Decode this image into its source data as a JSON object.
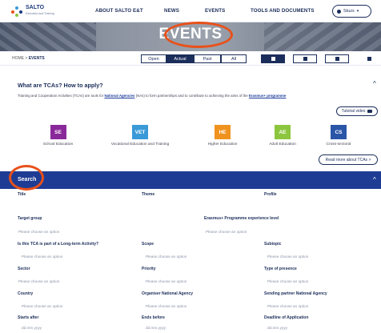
{
  "header": {
    "logo_text": "SALTO",
    "logo_sub": "Education and Training",
    "nav": [
      "ABOUT SALTO E&T",
      "NEWS",
      "EVENTS",
      "TOOLS AND DOCUMENTS"
    ],
    "user_label": "Stuzs"
  },
  "banner": {
    "title": "EVENTS"
  },
  "breadcrumb": {
    "home": "HOME",
    "separator": ">",
    "current": "EVENTS"
  },
  "filters": {
    "time": [
      "Open",
      "Actual",
      "Past",
      "All"
    ],
    "active_time": "Actual"
  },
  "info": {
    "title": "What are TCAs? How to apply?",
    "text_before": "Training and Cooperation Activities (TCAs) are tools for ",
    "link1": "National Agencies",
    "text_middle": " (NAs) to form partnerships and to contribute to achieving the aims of the ",
    "link2": "Erasmus+ programme",
    "tutorial_label": "Tutorial video",
    "more_label": "Read more about TCAs >"
  },
  "categories": [
    {
      "code": "SE",
      "label": "School Education",
      "color": "#8a2a9a"
    },
    {
      "code": "VET",
      "label": "Vocational Education and Training",
      "color": "#3a9ad8"
    },
    {
      "code": "HE",
      "label": "Higher Education",
      "color": "#f0921e"
    },
    {
      "code": "AE",
      "label": "Adult Education",
      "color": "#8cc63f"
    },
    {
      "code": "CS",
      "label": "Cross-sectoral",
      "color": "#2a56a8"
    }
  ],
  "search": {
    "label": "Search",
    "fields": {
      "title": "Title",
      "theme": "Theme",
      "profile": "Profile",
      "target_group": "Target group",
      "target_group_ph": "Please choose an option",
      "experience": "Erasmus+ Programme experience level",
      "experience_ph": "Please choose an option",
      "long_term": "Is this TCA is part of a Long-term Activity?",
      "long_term_ph": "Please choose an option",
      "scope": "Scope",
      "scope_ph": "Please choose an option",
      "subtopic": "Subtopic",
      "subtopic_ph": "Please choose an option",
      "sector": "Sector",
      "sector_ph": "Please choose an option",
      "priority": "Priority",
      "priority_ph": "Please choose an option",
      "presence": "Type of presence",
      "presence_ph": "Please choose an option",
      "country": "Country",
      "country_ph": "Please choose an option",
      "organiser": "Organiser National Agency",
      "organiser_ph": "Please choose an option",
      "sending": "Sending partner National Agency",
      "sending_ph": "Please choose an option",
      "starts_after": "Starts after",
      "starts_after_ph": "dd.mm.yyyy",
      "ends_before": "Ends before",
      "ends_before_ph": "dd.mm.yyyy",
      "deadline": "Deadline of Application",
      "deadline_ph": "dd.mm.yyyy"
    }
  },
  "colors": {
    "primary": "#1f3c94",
    "highlight_ring": "#e8511a"
  }
}
